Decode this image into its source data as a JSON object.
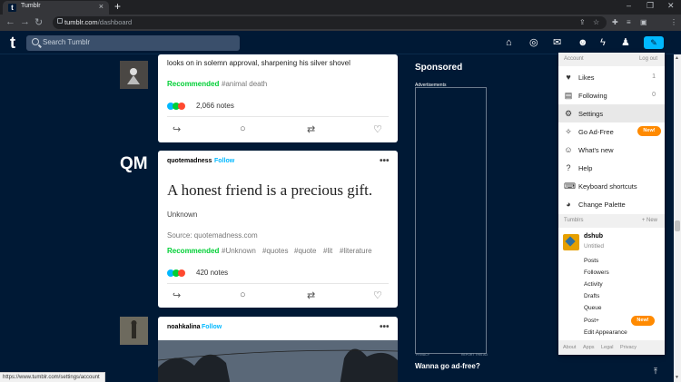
{
  "browser": {
    "tab_title": "Tumblr",
    "tab_close": "×",
    "new_tab": "+",
    "url_host": "tumblr.com",
    "url_path": "/dashboard",
    "window_min": "–",
    "window_max": "❐",
    "window_close": "✕"
  },
  "header": {
    "logo": "t",
    "search_placeholder": "Search Tumblr"
  },
  "posts": [
    {
      "text": "looks on in solemn approval, sharpening his silver shovel",
      "recommended": "Recommended",
      "tags": [
        "#animal death"
      ],
      "notes": "2,066 notes"
    },
    {
      "blog": "quotemadness",
      "follow": "Follow",
      "menu": "•••",
      "quote": "A honest friend is a precious gift.",
      "author": "Unknown",
      "source": "Source: quotemadness.com",
      "recommended": "Recommended",
      "tags": [
        "#Unknown",
        "#quotes",
        "#quote",
        "#lit",
        "#literature"
      ],
      "notes": "420 notes"
    },
    {
      "blog": "noahkalina",
      "follow": "Follow",
      "menu": "•••"
    }
  ],
  "qm_logo": "QM",
  "sidebar": {
    "sponsored": "Sponsored",
    "ad_label": "Advertisements",
    "ad_privacy": "PRIVACY",
    "ad_report": "REPORT THIS AD",
    "wanna": "Wanna go ad-free?"
  },
  "account_menu": {
    "account_label": "Account",
    "logout": "Log out",
    "items": [
      {
        "label": "Likes",
        "count": "1",
        "icon": "heart-icon"
      },
      {
        "label": "Following",
        "count": "0",
        "icon": "following-icon"
      },
      {
        "label": "Settings",
        "count": "",
        "icon": "gear-icon"
      },
      {
        "label": "Go Ad-Free",
        "count": "",
        "icon": "sparkle-icon"
      },
      {
        "label": "What's new",
        "count": "",
        "icon": "smile-icon"
      },
      {
        "label": "Help",
        "count": "",
        "icon": "help-icon"
      },
      {
        "label": "Keyboard shortcuts",
        "count": "",
        "icon": "keyboard-icon"
      },
      {
        "label": "Change Palette",
        "count": "",
        "icon": "palette-icon"
      }
    ],
    "new_badge": "New!",
    "tumblrs_label": "Tumblrs",
    "new_blog": "+ New",
    "blog_name": "dshub",
    "blog_title": "Untitled",
    "blog_links": [
      "Posts",
      "Followers",
      "Activity",
      "Drafts",
      "Queue",
      "Post+",
      "Edit Appearance"
    ],
    "footer": [
      "About",
      "Apps",
      "Legal",
      "Privacy"
    ]
  },
  "status_url": "https://www.tumblr.com/settings/account",
  "colors": {
    "tumblr_navy": "#001935",
    "accent_blue": "#00b8ff",
    "recommended_green": "#00cf35",
    "new_badge_orange": "#ff8a00"
  }
}
